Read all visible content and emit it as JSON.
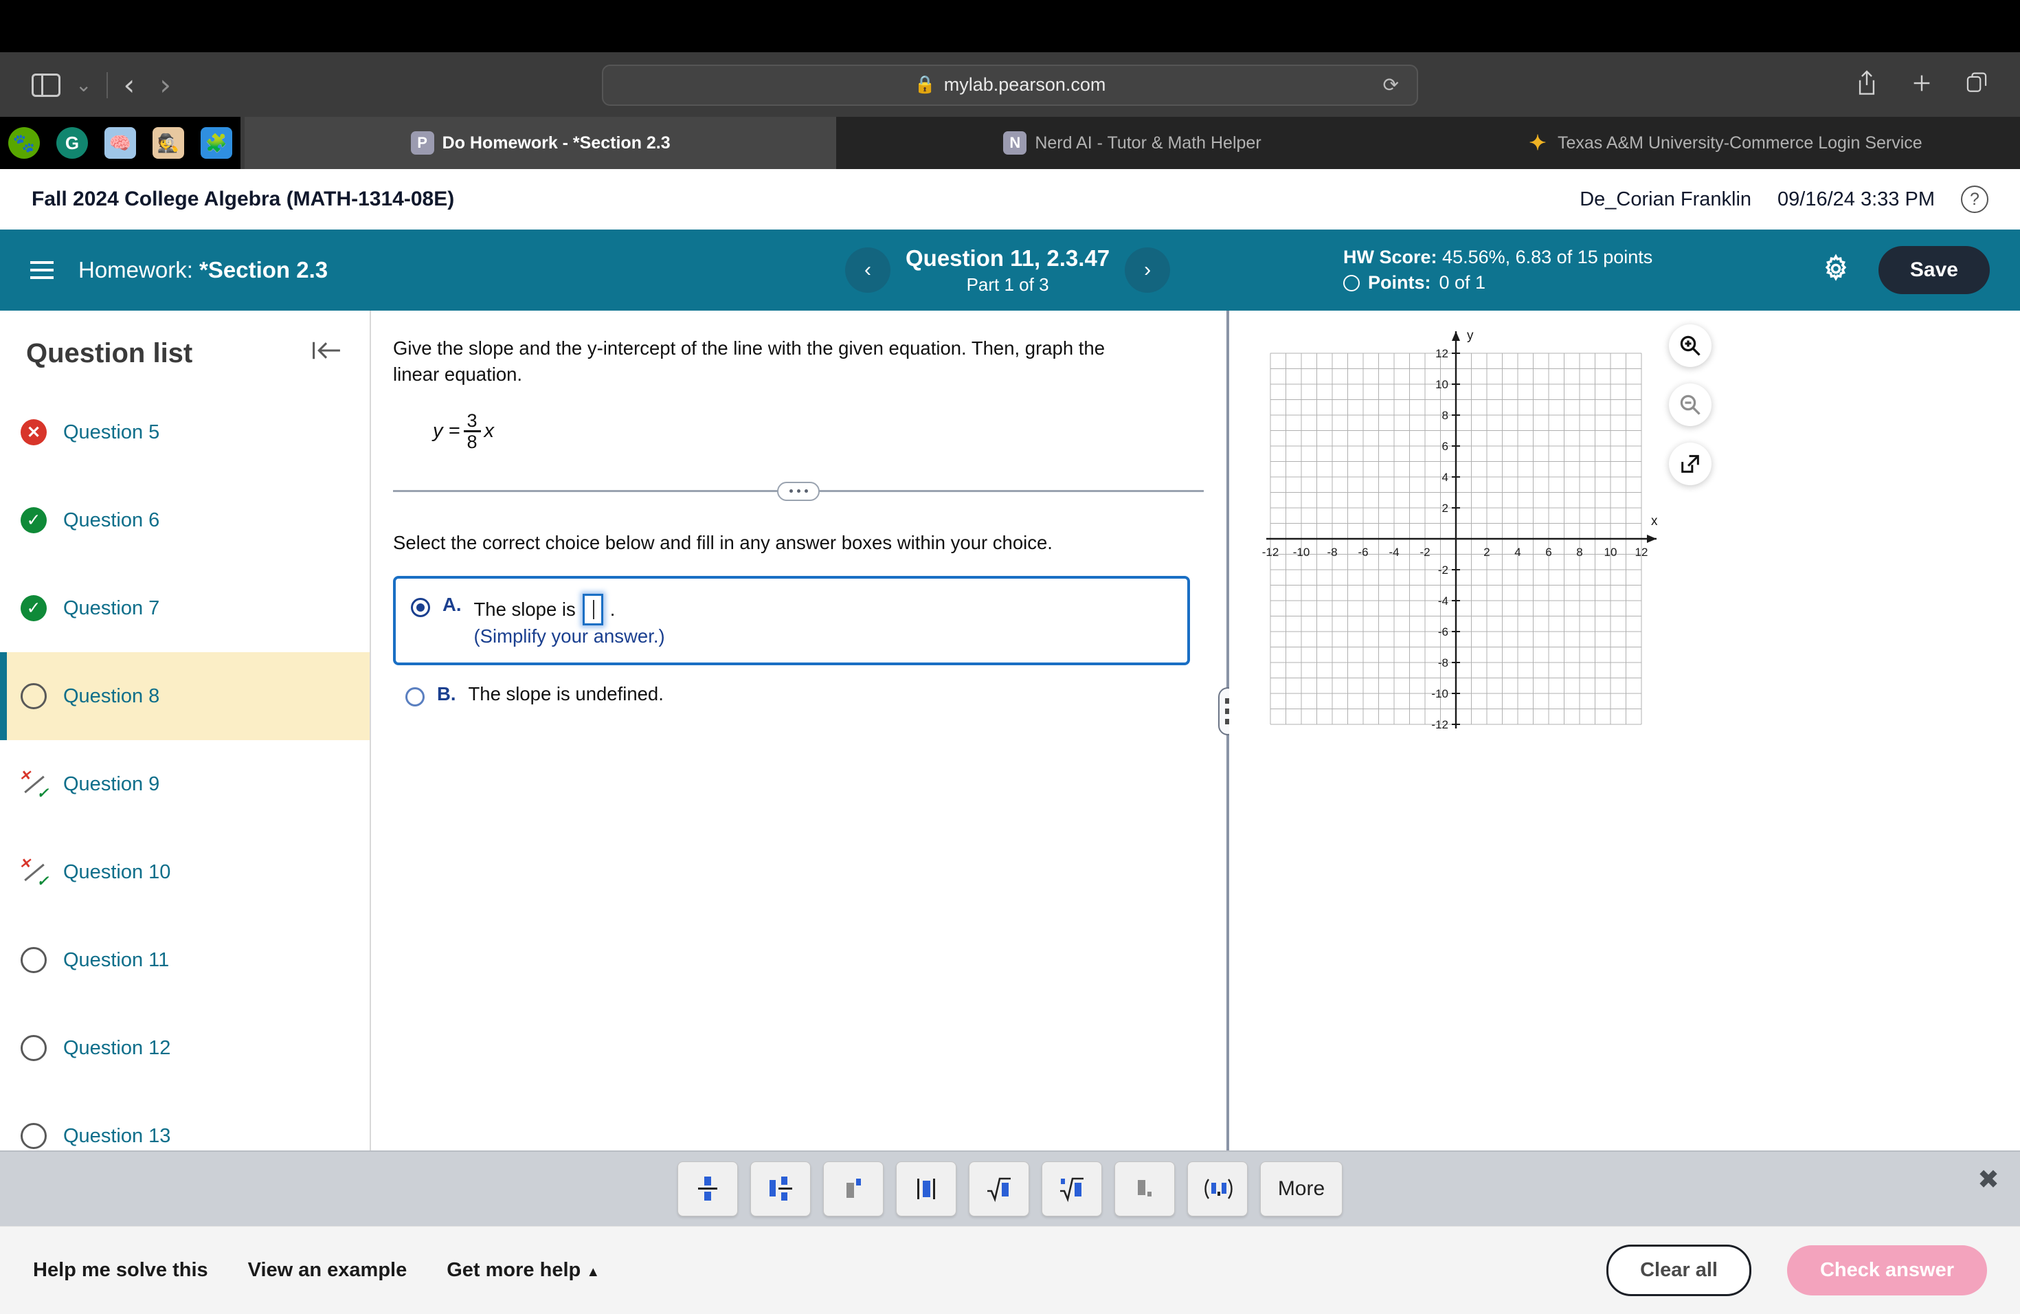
{
  "browser": {
    "url": "mylab.pearson.com",
    "lock_icon": "lock-icon",
    "reload_icon": "reload-icon",
    "share_icon": "share-icon",
    "newtab_icon": "plus-icon",
    "tabs_icon": "tab-overview-icon",
    "back_icon": "chevron-left-icon",
    "forward_icon": "chevron-right-icon",
    "sidebar_icon": "sidebar-toggle-icon",
    "favorites": [
      {
        "name": "favicon-duolingo",
        "glyph": "●",
        "color": "#58a700"
      },
      {
        "name": "favicon-grammarly",
        "glyph": "G",
        "color": "#11866f"
      },
      {
        "name": "favicon-brainly",
        "glyph": "■",
        "color": "#9fc6e8"
      },
      {
        "name": "favicon-nerdai",
        "glyph": "●",
        "color": "#e8c8a0"
      },
      {
        "name": "favicon-gauth",
        "glyph": "◆",
        "color": "#2f8fe0"
      }
    ],
    "tabs": [
      {
        "label": "Do Homework - *Section 2.3",
        "badge": "P",
        "badge_color": "#9b9bb0",
        "active": true
      },
      {
        "label": "Nerd AI - Tutor & Math Helper",
        "badge": "N",
        "badge_color": "#9b9bb0",
        "active": false
      },
      {
        "label": "Texas A&M University-Commerce Login Service",
        "badge": "●",
        "badge_color": "#f0b323",
        "active": false
      }
    ]
  },
  "course_header": {
    "title": "Fall 2024 College Algebra (MATH-1314-08E)",
    "user": "De_Corian Franklin",
    "timestamp": "09/16/24 3:33 PM",
    "help_glyph": "?"
  },
  "hw_bar": {
    "menu_icon": "hamburger-icon",
    "label_prefix": "Homework:",
    "label_value": "*Section 2.3",
    "prev_glyph": "‹",
    "next_glyph": "›",
    "question_title": "Question 11, 2.3.47",
    "part_text": "Part 1 of 3",
    "hw_score_label": "HW Score:",
    "hw_score_value": "45.56%, 6.83 of 15 points",
    "points_label": "Points:",
    "points_value": "0 of 1",
    "settings_icon": "gear-icon",
    "save_label": "Save",
    "accent_color": "#0e7490"
  },
  "sidebar": {
    "title": "Question list",
    "collapse_icon": "collapse-left-icon",
    "items": [
      {
        "label": "Question 5",
        "status": "wrong"
      },
      {
        "label": "Question 6",
        "status": "right"
      },
      {
        "label": "Question 7",
        "status": "right"
      },
      {
        "label": "Question 8",
        "status": "empty",
        "active": true
      },
      {
        "label": "Question 9",
        "status": "partial"
      },
      {
        "label": "Question 10",
        "status": "partial"
      },
      {
        "label": "Question 11",
        "status": "empty"
      },
      {
        "label": "Question 12",
        "status": "empty"
      },
      {
        "label": "Question 13",
        "status": "empty"
      }
    ]
  },
  "question": {
    "prompt": "Give the slope and the y-intercept of the line with the given equation.  Then, graph the linear equation.",
    "equation_lhs": "y =",
    "equation_numerator": "3",
    "equation_denominator": "8",
    "equation_variable": "x",
    "divider_icon": "ellipsis-handle",
    "instruction": "Select the correct choice below and fill in any answer boxes within your choice.",
    "choices": [
      {
        "letter": "A.",
        "text": "The slope is",
        "after_box": ".",
        "note": "(Simplify your answer.)",
        "selected": true,
        "has_input": true,
        "input_value": ""
      },
      {
        "letter": "B.",
        "text": "The slope is undefined.",
        "selected": false,
        "has_input": false
      }
    ]
  },
  "graph_tools": [
    {
      "name": "zoom-in-icon"
    },
    {
      "name": "zoom-out-icon"
    },
    {
      "name": "open-external-icon"
    }
  ],
  "chart_data": {
    "type": "scatter",
    "title": "",
    "xlabel": "x",
    "ylabel": "y",
    "xlim": [
      -12,
      12
    ],
    "ylim": [
      -12,
      12
    ],
    "xticks": [
      -12,
      -10,
      -8,
      -6,
      -4,
      -2,
      2,
      4,
      6,
      8,
      10,
      12
    ],
    "yticks": [
      12,
      10,
      8,
      6,
      4,
      2,
      -2,
      -4,
      -6,
      -8,
      -10,
      -12
    ],
    "grid": true,
    "grid_step": 1,
    "legend": "none",
    "series": [],
    "note": "Empty coordinate plane for student graphing; no plotted data"
  },
  "math_toolbar": {
    "buttons": [
      {
        "name": "fraction-button",
        "glyph": "fraction"
      },
      {
        "name": "mixed-number-button",
        "glyph": "mixed"
      },
      {
        "name": "exponent-button",
        "glyph": "power"
      },
      {
        "name": "absolute-value-button",
        "glyph": "abs"
      },
      {
        "name": "square-root-button",
        "glyph": "sqrt"
      },
      {
        "name": "nth-root-button",
        "glyph": "nroot"
      },
      {
        "name": "subscript-button",
        "glyph": "subscript"
      },
      {
        "name": "ordered-pair-button",
        "glyph": "pair"
      },
      {
        "name": "more-button",
        "glyph": "text",
        "label": "More"
      }
    ],
    "close_icon": "close-icon"
  },
  "footer": {
    "links": [
      "Help me solve this",
      "View an example",
      "Get more help"
    ],
    "get_more_help_caret": "▲",
    "clear_all_label": "Clear all",
    "check_answer_label": "Check answer",
    "check_answer_color": "#f3a3bd"
  }
}
